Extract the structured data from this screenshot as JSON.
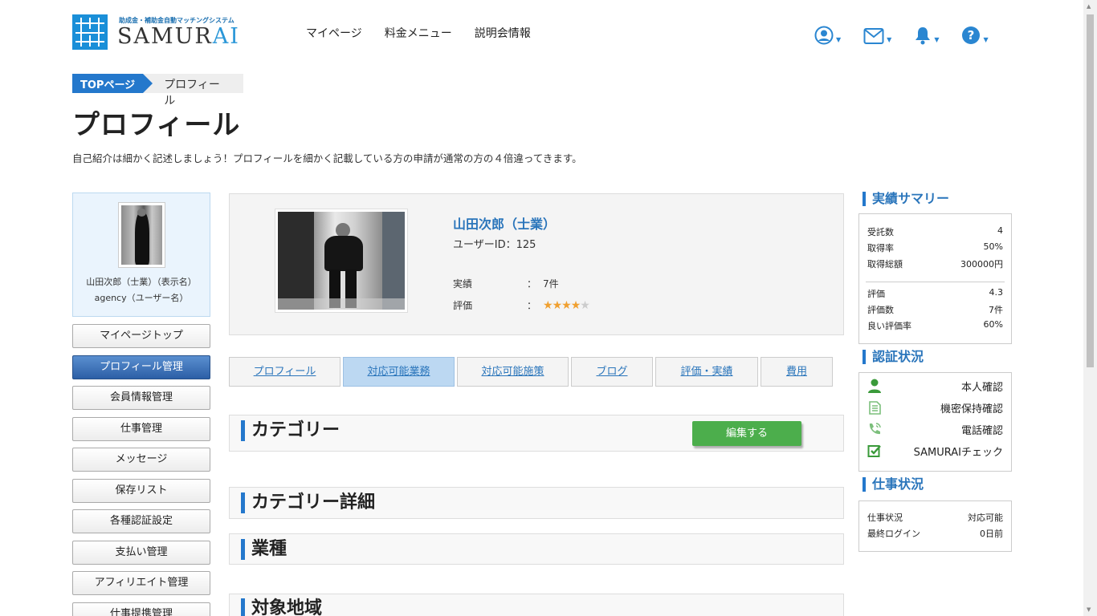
{
  "header": {
    "logo_sub": "助成金・補助金自動マッチングシステム",
    "logo_main": "SAMURAI",
    "nav": [
      "マイページ",
      "料金メニュー",
      "説明会情報"
    ]
  },
  "breadcrumb": {
    "top": "TOPページ",
    "current": "プロフィール"
  },
  "page": {
    "title": "プロフィール",
    "lead": "自己紹介は細かく記述しましょう！プロフィールを細かく記載している方の申請が通常の方の４倍違ってきます。"
  },
  "sidebar": {
    "display_name": "山田次郎（士業）（表示名）",
    "user_name": "agency（ユーザー名）",
    "items": [
      "マイページトップ",
      "プロフィール管理",
      "会員情報管理",
      "仕事管理",
      "メッセージ",
      "保存リスト",
      "各種認証設定",
      "支払い管理",
      "アフィリエイト管理",
      "仕事提携管理"
    ],
    "active_index": 1
  },
  "profile": {
    "name": "山田次郎（士業）",
    "user_id": "ユーザーID：125",
    "results_label": "実績",
    "results_value": "7件",
    "rating_label": "評価",
    "colon": "：",
    "rating_stars": 4.3
  },
  "tabs": [
    "プロフィール",
    "対応可能業務",
    "対応可能施策",
    "ブログ",
    "評価・実績",
    "費用"
  ],
  "active_tab": 1,
  "sections": {
    "category": "カテゴリー",
    "edit": "編集する",
    "category_detail": "カテゴリー詳細",
    "industry": "業種",
    "region": "対象地域"
  },
  "summary": {
    "title": "実績サマリー",
    "rows1": [
      {
        "k": "受託数",
        "v": "4"
      },
      {
        "k": "取得率",
        "v": "50%"
      },
      {
        "k": "取得総額",
        "v": "300000円"
      }
    ],
    "rows2": [
      {
        "k": "評価",
        "v": "4.3"
      },
      {
        "k": "評価数",
        "v": "7件"
      },
      {
        "k": "良い評価率",
        "v": "60%"
      }
    ]
  },
  "certs": {
    "title": "認証状況",
    "items": [
      "本人確認",
      "機密保持確認",
      "電話確認",
      "SAMURAIチェック"
    ]
  },
  "work": {
    "title": "仕事状況",
    "rows": [
      {
        "k": "仕事状況",
        "v": "対応可能"
      },
      {
        "k": "最終ログイン",
        "v": "0日前"
      }
    ]
  },
  "colors": {
    "accent": "#2478cc",
    "link": "#2a75bb",
    "edit": "#4cae4c"
  }
}
